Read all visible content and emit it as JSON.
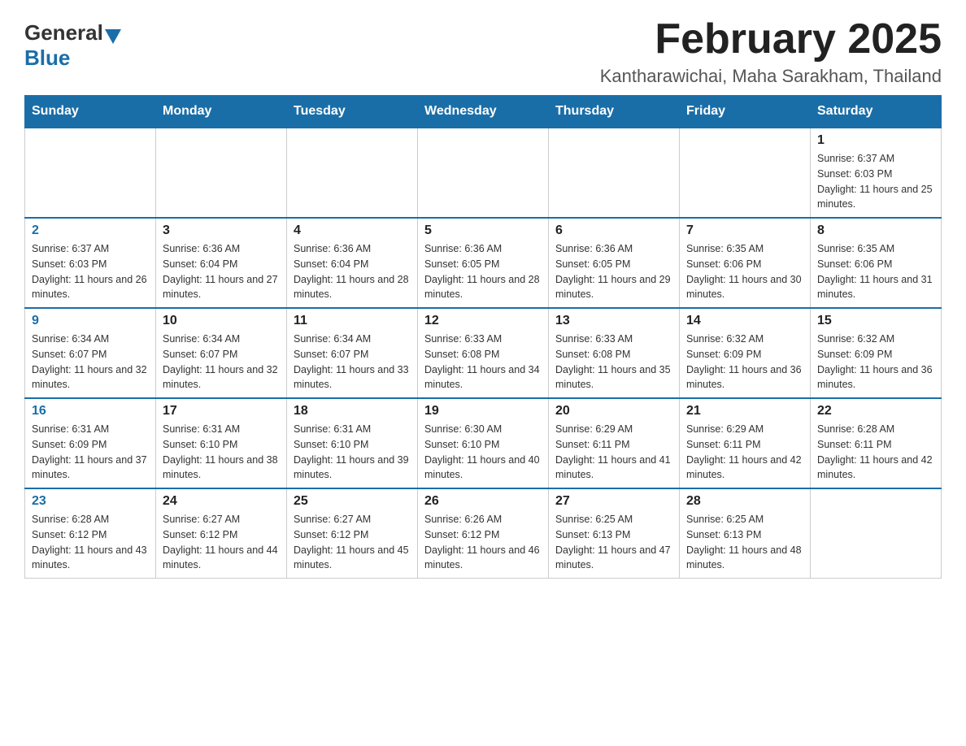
{
  "header": {
    "logo_general": "General",
    "logo_blue": "Blue",
    "title": "February 2025",
    "subtitle": "Kantharawichai, Maha Sarakham, Thailand"
  },
  "days_of_week": [
    "Sunday",
    "Monday",
    "Tuesday",
    "Wednesday",
    "Thursday",
    "Friday",
    "Saturday"
  ],
  "weeks": [
    [
      {
        "day": "",
        "info": ""
      },
      {
        "day": "",
        "info": ""
      },
      {
        "day": "",
        "info": ""
      },
      {
        "day": "",
        "info": ""
      },
      {
        "day": "",
        "info": ""
      },
      {
        "day": "",
        "info": ""
      },
      {
        "day": "1",
        "info": "Sunrise: 6:37 AM\nSunset: 6:03 PM\nDaylight: 11 hours and 25 minutes."
      }
    ],
    [
      {
        "day": "2",
        "info": "Sunrise: 6:37 AM\nSunset: 6:03 PM\nDaylight: 11 hours and 26 minutes."
      },
      {
        "day": "3",
        "info": "Sunrise: 6:36 AM\nSunset: 6:04 PM\nDaylight: 11 hours and 27 minutes."
      },
      {
        "day": "4",
        "info": "Sunrise: 6:36 AM\nSunset: 6:04 PM\nDaylight: 11 hours and 28 minutes."
      },
      {
        "day": "5",
        "info": "Sunrise: 6:36 AM\nSunset: 6:05 PM\nDaylight: 11 hours and 28 minutes."
      },
      {
        "day": "6",
        "info": "Sunrise: 6:36 AM\nSunset: 6:05 PM\nDaylight: 11 hours and 29 minutes."
      },
      {
        "day": "7",
        "info": "Sunrise: 6:35 AM\nSunset: 6:06 PM\nDaylight: 11 hours and 30 minutes."
      },
      {
        "day": "8",
        "info": "Sunrise: 6:35 AM\nSunset: 6:06 PM\nDaylight: 11 hours and 31 minutes."
      }
    ],
    [
      {
        "day": "9",
        "info": "Sunrise: 6:34 AM\nSunset: 6:07 PM\nDaylight: 11 hours and 32 minutes."
      },
      {
        "day": "10",
        "info": "Sunrise: 6:34 AM\nSunset: 6:07 PM\nDaylight: 11 hours and 32 minutes."
      },
      {
        "day": "11",
        "info": "Sunrise: 6:34 AM\nSunset: 6:07 PM\nDaylight: 11 hours and 33 minutes."
      },
      {
        "day": "12",
        "info": "Sunrise: 6:33 AM\nSunset: 6:08 PM\nDaylight: 11 hours and 34 minutes."
      },
      {
        "day": "13",
        "info": "Sunrise: 6:33 AM\nSunset: 6:08 PM\nDaylight: 11 hours and 35 minutes."
      },
      {
        "day": "14",
        "info": "Sunrise: 6:32 AM\nSunset: 6:09 PM\nDaylight: 11 hours and 36 minutes."
      },
      {
        "day": "15",
        "info": "Sunrise: 6:32 AM\nSunset: 6:09 PM\nDaylight: 11 hours and 36 minutes."
      }
    ],
    [
      {
        "day": "16",
        "info": "Sunrise: 6:31 AM\nSunset: 6:09 PM\nDaylight: 11 hours and 37 minutes."
      },
      {
        "day": "17",
        "info": "Sunrise: 6:31 AM\nSunset: 6:10 PM\nDaylight: 11 hours and 38 minutes."
      },
      {
        "day": "18",
        "info": "Sunrise: 6:31 AM\nSunset: 6:10 PM\nDaylight: 11 hours and 39 minutes."
      },
      {
        "day": "19",
        "info": "Sunrise: 6:30 AM\nSunset: 6:10 PM\nDaylight: 11 hours and 40 minutes."
      },
      {
        "day": "20",
        "info": "Sunrise: 6:29 AM\nSunset: 6:11 PM\nDaylight: 11 hours and 41 minutes."
      },
      {
        "day": "21",
        "info": "Sunrise: 6:29 AM\nSunset: 6:11 PM\nDaylight: 11 hours and 42 minutes."
      },
      {
        "day": "22",
        "info": "Sunrise: 6:28 AM\nSunset: 6:11 PM\nDaylight: 11 hours and 42 minutes."
      }
    ],
    [
      {
        "day": "23",
        "info": "Sunrise: 6:28 AM\nSunset: 6:12 PM\nDaylight: 11 hours and 43 minutes."
      },
      {
        "day": "24",
        "info": "Sunrise: 6:27 AM\nSunset: 6:12 PM\nDaylight: 11 hours and 44 minutes."
      },
      {
        "day": "25",
        "info": "Sunrise: 6:27 AM\nSunset: 6:12 PM\nDaylight: 11 hours and 45 minutes."
      },
      {
        "day": "26",
        "info": "Sunrise: 6:26 AM\nSunset: 6:12 PM\nDaylight: 11 hours and 46 minutes."
      },
      {
        "day": "27",
        "info": "Sunrise: 6:25 AM\nSunset: 6:13 PM\nDaylight: 11 hours and 47 minutes."
      },
      {
        "day": "28",
        "info": "Sunrise: 6:25 AM\nSunset: 6:13 PM\nDaylight: 11 hours and 48 minutes."
      },
      {
        "day": "",
        "info": ""
      }
    ]
  ]
}
